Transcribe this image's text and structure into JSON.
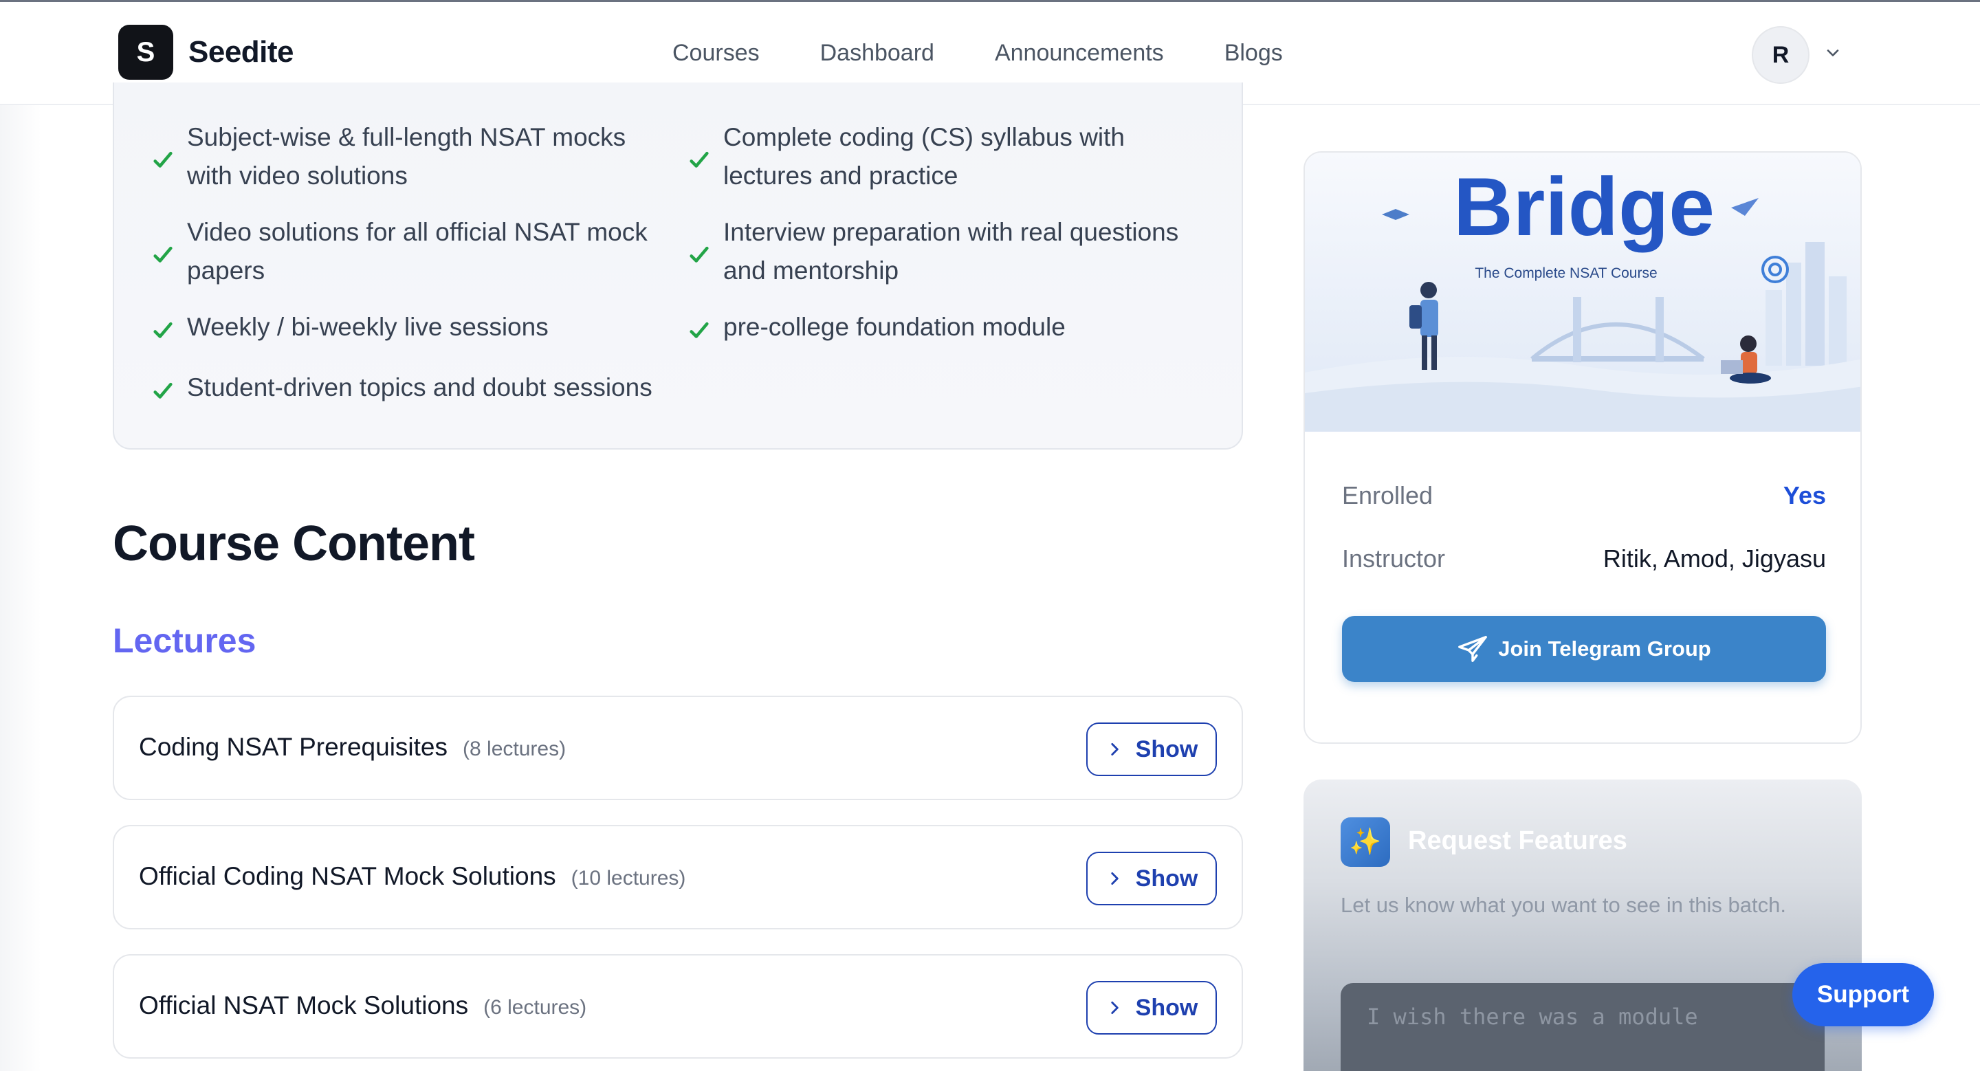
{
  "nav": {
    "brand_letter": "S",
    "brand_name": "Seedite",
    "links": [
      "Courses",
      "Dashboard",
      "Announcements",
      "Blogs"
    ],
    "avatar_initial": "R"
  },
  "features": [
    "Subject-wise & full-length NSAT mocks with video solutions",
    "Complete coding (CS) syllabus with lectures and practice",
    "Video solutions for all official NSAT mock papers",
    "Interview preparation with real questions and mentorship",
    "Weekly / bi-weekly live sessions",
    "pre-college foundation module",
    "Student-driven topics and doubt sessions"
  ],
  "content": {
    "title": "Course Content",
    "lectures_heading": "Lectures",
    "show_label": "Show",
    "modules": [
      {
        "name": "Coding NSAT Prerequisites",
        "count": "(8 lectures)"
      },
      {
        "name": "Official Coding NSAT Mock Solutions",
        "count": "(10 lectures)"
      },
      {
        "name": "Official NSAT Mock Solutions",
        "count": "(6 lectures)"
      }
    ]
  },
  "course_card": {
    "banner_title": "Bridge",
    "banner_subtitle": "The Complete NSAT Course",
    "enrolled_label": "Enrolled",
    "enrolled_value": "Yes",
    "instructor_label": "Instructor",
    "instructor_value": "Ritik, Amod, Jigyasu",
    "telegram_label": "Join Telegram Group"
  },
  "request": {
    "icon": "sparkles-icon",
    "title": "Request Features",
    "description": "Let us know what you want to see in this batch.",
    "placeholder": "I wish there was a module"
  },
  "support_label": "Support",
  "colors": {
    "accent": "#1e40af",
    "lectures_heading": "#6366f1",
    "check": "#16a34a",
    "telegram": "#3b84c9",
    "support": "#2563eb"
  }
}
